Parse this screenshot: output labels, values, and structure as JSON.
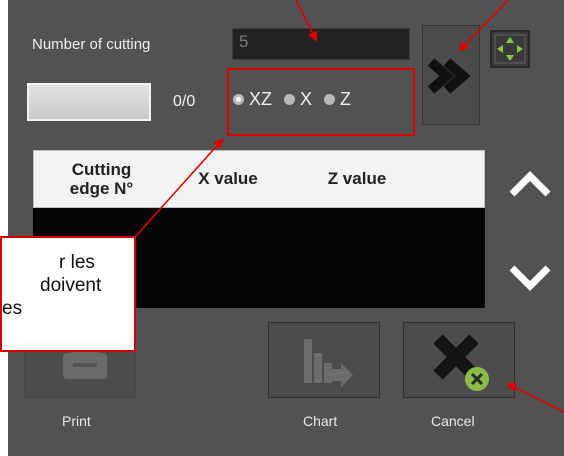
{
  "number_of_cutting": {
    "label": "Number of cutting",
    "value": "5"
  },
  "counter": "0/0",
  "axis_radios": [
    {
      "label": "XZ",
      "selected": true
    },
    {
      "label": "X",
      "selected": false
    },
    {
      "label": "Z",
      "selected": false
    }
  ],
  "table": {
    "headers": [
      "Cutting\nedge N°",
      "X value",
      "Z value"
    ],
    "rows": []
  },
  "buttons": {
    "print": "Print",
    "chart": "Chart",
    "cancel": "Cancel"
  },
  "icons": {
    "next": "double-chevron-right-icon",
    "navigate": "four-arrows-icon",
    "scroll_up": "chevron-up-icon",
    "scroll_down": "chevron-down-icon",
    "print": "printer-icon",
    "chart": "chart-export-icon",
    "cancel": "cancel-x-icon"
  },
  "callout": {
    "lines": [
      "r les",
      "doivent",
      "es"
    ]
  },
  "colors": {
    "background": "#525252",
    "table_header": "#f3f3f3",
    "table_body": "#050505",
    "annotation_red": "#e00000",
    "nav_icon_green": "#8dc63f",
    "cancel_green": "#8dbb4a"
  }
}
